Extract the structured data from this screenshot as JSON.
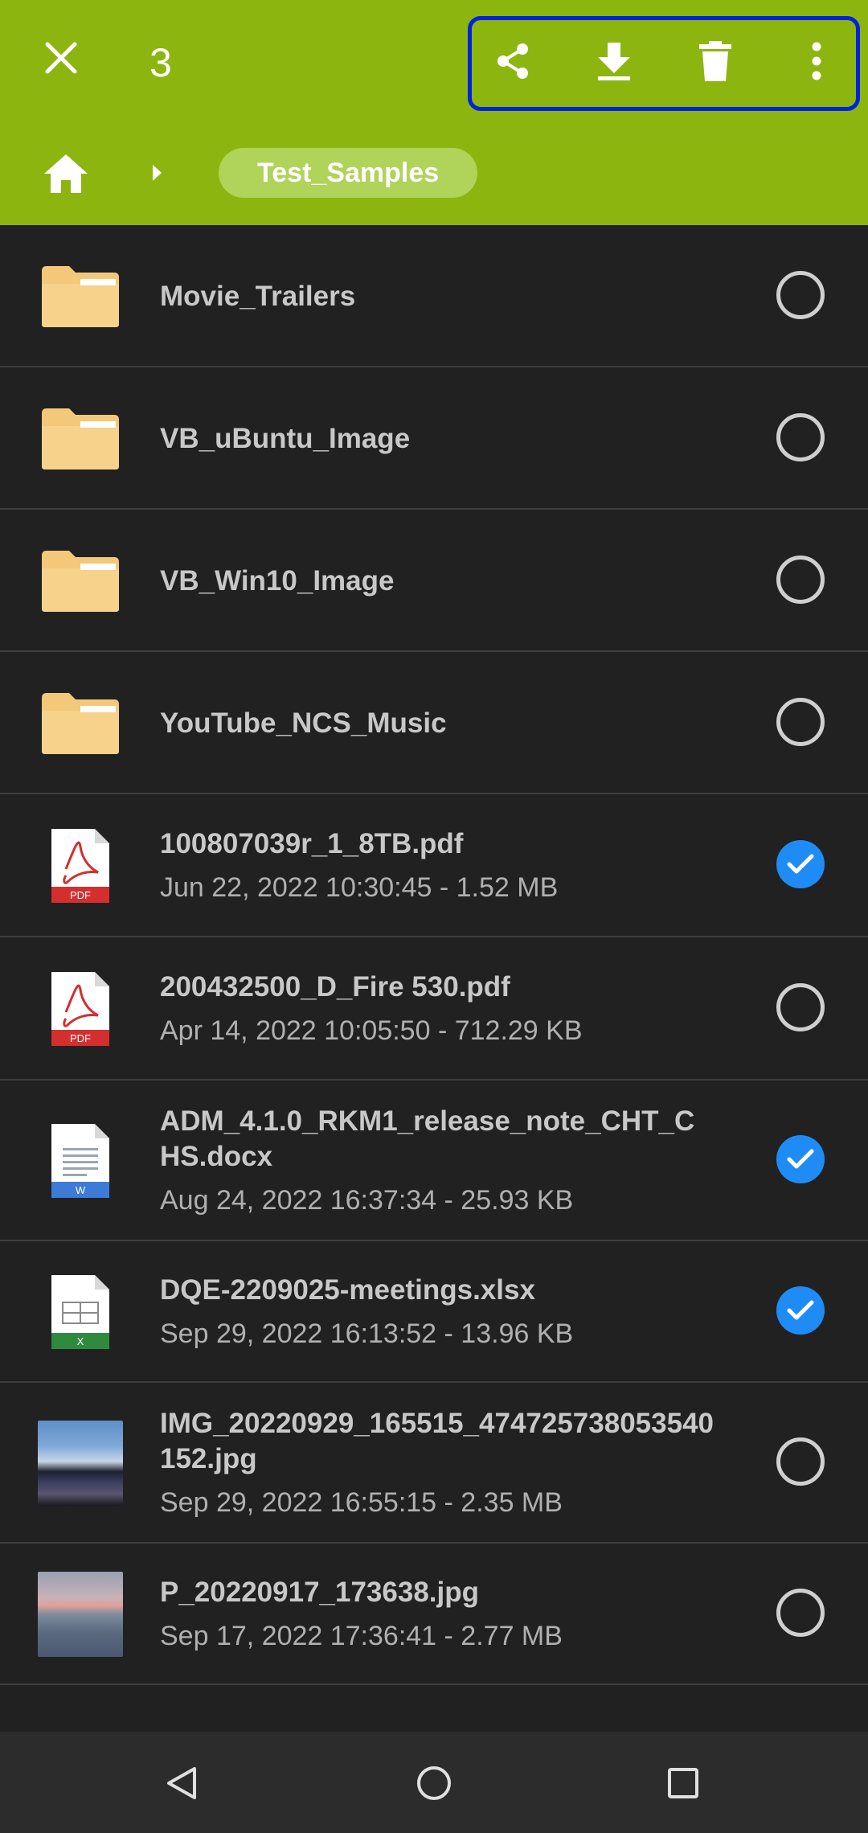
{
  "toolbar": {
    "selected_count": "3",
    "close_icon": "close-icon",
    "actions": [
      "share-icon",
      "download-icon",
      "delete-icon",
      "more-vert-icon"
    ]
  },
  "breadcrumb": {
    "home_icon": "home-icon",
    "current": "Test_Samples"
  },
  "files": [
    {
      "name": "Movie_Trailers",
      "meta": "",
      "type": "folder",
      "selected": false
    },
    {
      "name": "VB_uBuntu_Image",
      "meta": "",
      "type": "folder",
      "selected": false
    },
    {
      "name": "VB_Win10_Image",
      "meta": "",
      "type": "folder",
      "selected": false
    },
    {
      "name": "YouTube_NCS_Music",
      "meta": "",
      "type": "folder",
      "selected": false
    },
    {
      "name": "100807039r_1_8TB.pdf",
      "meta": "Jun 22, 2022 10:30:45 - 1.52 MB",
      "type": "pdf",
      "selected": true
    },
    {
      "name": "200432500_D_Fire 530.pdf",
      "meta": "Apr 14, 2022 10:05:50 - 712.29 KB",
      "type": "pdf",
      "selected": false
    },
    {
      "name": "ADM_4.1.0_RKM1_release_note_CHT_CHS.docx",
      "meta": "Aug 24, 2022 16:37:34 - 25.93 KB",
      "type": "docx",
      "selected": true
    },
    {
      "name": "DQE-2209025-meetings.xlsx",
      "meta": "Sep 29, 2022 16:13:52 - 13.96 KB",
      "type": "xlsx",
      "selected": true
    },
    {
      "name": "IMG_20220929_165515_474725738053540152.jpg",
      "meta": "Sep 29, 2022 16:55:15 - 2.35 MB",
      "type": "image",
      "selected": false
    },
    {
      "name": "P_20220917_173638.jpg",
      "meta": "Sep 17, 2022 17:36:41 - 2.77 MB",
      "type": "photo",
      "selected": false
    }
  ],
  "icon_labels": {
    "pdf": "PDF",
    "docx": "W",
    "xlsx": "X"
  },
  "colors": {
    "accent": "#8cb60f",
    "chip": "#b0d35a",
    "check": "#1f8cf5",
    "highlight": "#0022e0"
  }
}
